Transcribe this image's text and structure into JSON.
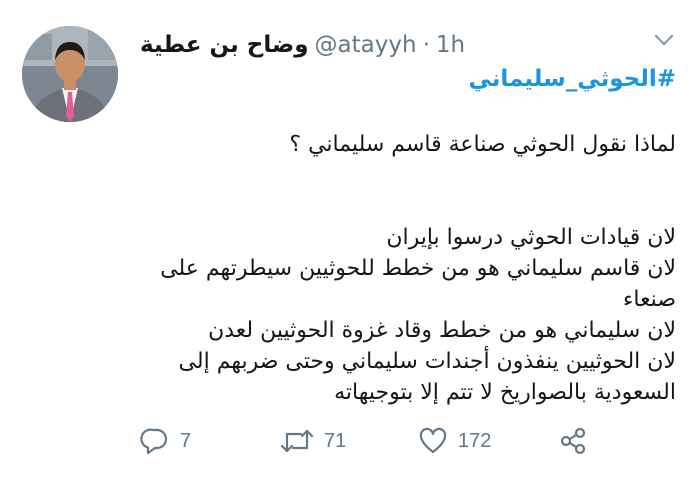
{
  "user": {
    "display_name": "وضاح بن عطية",
    "handle": "@atayyh",
    "separator": "·",
    "time": "1h",
    "avatar": "avatar-photo"
  },
  "tweet": {
    "hashtag": "#الحوثي_سليماني",
    "lines": [
      "لماذا نقول الحوثي صناعة قاسم سليماني ؟",
      "",
      "لان قيادات الحوثي درسوا بإيران",
      "لان قاسم سليماني هو من خطط للحوثيين سيطرتهم على",
      "صنعاء",
      "لان سليماني هو من خطط وقاد غزوة الحوثيين لعدن",
      "لان الحوثيين ينفذون أجندات سليماني وحتى ضربهم إلى",
      "السعودية بالصواريخ لا تتم إلا بتوجيهاته"
    ]
  },
  "actions": {
    "reply_count": "7",
    "retweet_count": "71",
    "like_count": "172",
    "icons": [
      "reply-icon",
      "retweet-icon",
      "like-icon",
      "share-icon"
    ]
  },
  "colors": {
    "accent": "#1b95e0",
    "muted": "#657786",
    "text": "#14171a"
  }
}
